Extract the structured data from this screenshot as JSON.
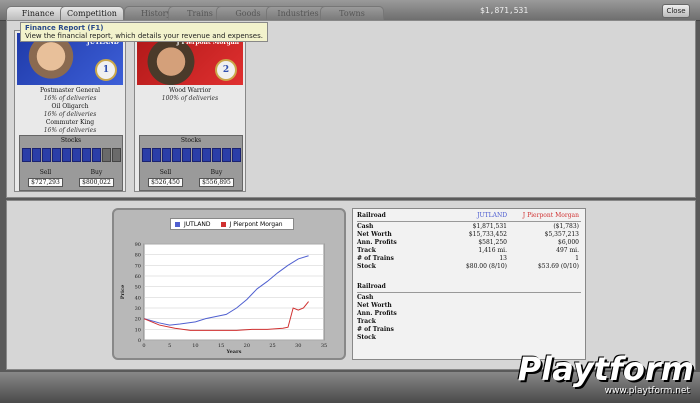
{
  "tabs": [
    {
      "label": "Finance"
    },
    {
      "label": "Competition"
    },
    {
      "label": "History"
    },
    {
      "label": "Trains"
    },
    {
      "label": "Goods"
    },
    {
      "label": "Industries"
    },
    {
      "label": "Towns"
    }
  ],
  "cash_display": "$1,871,531",
  "close_label": "Close",
  "tooltip": {
    "title": "Finance Report (F1)",
    "text": "View the financial report, which details your revenue and expenses."
  },
  "players": [
    {
      "company": "JUTLAND",
      "rank": "1",
      "titles": [
        {
          "name": "Postmaster General",
          "note": "16% of deliveries"
        },
        {
          "name": "Oil Oligarch",
          "note": "16% of deliveries"
        },
        {
          "name": "Commuter King",
          "note": "16% of deliveries"
        }
      ],
      "stocks_label": "Stocks",
      "owned": 8,
      "total": 10,
      "sell_label": "Sell",
      "buy_label": "Buy",
      "sell": "$727,293",
      "buy": "$800,022"
    },
    {
      "company": "J Pierpont Morgan",
      "rank": "2",
      "titles": [
        {
          "name": "Wood Warrior",
          "note": "100% of deliveries"
        }
      ],
      "stocks_label": "Stocks",
      "owned": 10,
      "total": 10,
      "sell_label": "Sell",
      "buy_label": "Buy",
      "sell": "$526,450",
      "buy": "$556,895"
    }
  ],
  "colors": {
    "p1": "#5060d0",
    "p2": "#d03030"
  },
  "chart_data": {
    "type": "line",
    "xlabel": "Years",
    "ylabel": "Price",
    "xlim": [
      0,
      35
    ],
    "ylim": [
      0,
      90
    ],
    "xticks": [
      0,
      5,
      10,
      15,
      20,
      25,
      30,
      35
    ],
    "yticks": [
      0,
      10,
      20,
      30,
      40,
      50,
      60,
      70,
      80,
      90
    ],
    "series": [
      {
        "name": "JUTLAND",
        "color": "#5060d0",
        "x": [
          0,
          3,
          5,
          7,
          10,
          12,
          14,
          16,
          18,
          20,
          22,
          24,
          26,
          28,
          30,
          32
        ],
        "y": [
          20,
          16,
          14,
          15,
          17,
          20,
          22,
          24,
          30,
          38,
          48,
          55,
          63,
          70,
          76,
          79
        ]
      },
      {
        "name": "J Pierpont Morgan",
        "color": "#d03030",
        "x": [
          0,
          3,
          6,
          9,
          12,
          15,
          18,
          21,
          24,
          27,
          28,
          29,
          30,
          31,
          32
        ],
        "y": [
          20,
          14,
          11,
          9,
          9,
          9,
          9,
          10,
          10,
          11,
          12,
          30,
          28,
          30,
          36
        ]
      }
    ]
  },
  "table": {
    "header": {
      "label": "Railroad",
      "p1": "JUTLAND",
      "p2": "J Pierpont Morgan"
    },
    "rows": [
      {
        "label": "Cash",
        "p1": "$1,871,531",
        "p2": "($1,783)"
      },
      {
        "label": "Net Worth",
        "p1": "$15,733,452",
        "p2": "$5,357,213"
      },
      {
        "label": "Ann. Profits",
        "p1": "$581,250",
        "p2": "$6,000"
      },
      {
        "label": "Track",
        "p1": "1,416 mi.",
        "p2": "497 mi."
      },
      {
        "label": "# of Trains",
        "p1": "13",
        "p2": "1"
      },
      {
        "label": "Stock",
        "p1": "$80.00 (8/10)",
        "p2": "$53.69 (0/10)"
      }
    ],
    "header2": {
      "label": "Railroad"
    },
    "rows2": [
      "Cash",
      "Net Worth",
      "Ann. Profits",
      "Track",
      "# of Trains",
      "Stock"
    ]
  },
  "watermark": {
    "text": "Playtform",
    "url": "www.playtform.net"
  }
}
